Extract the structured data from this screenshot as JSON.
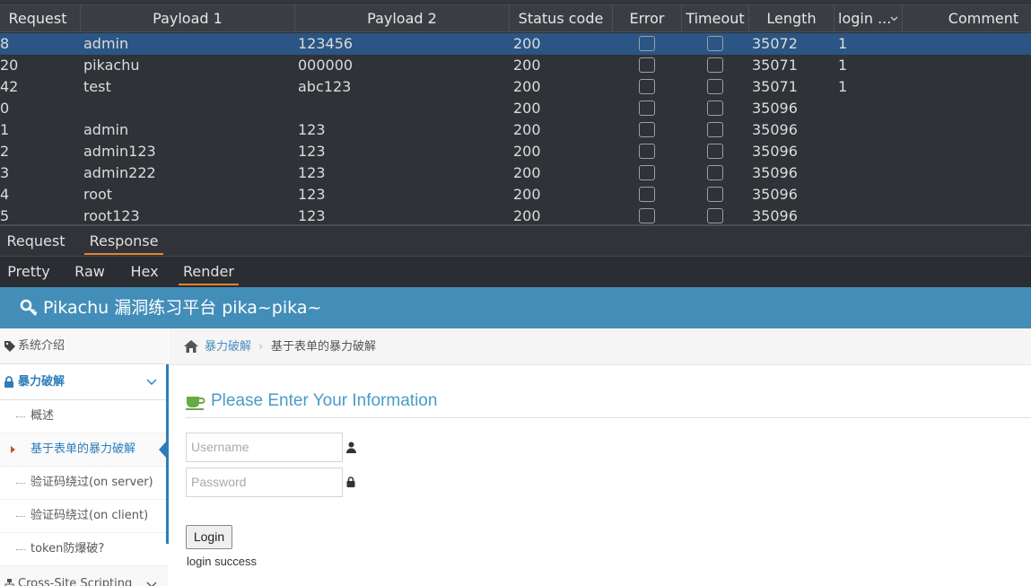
{
  "results": {
    "columns": [
      "Request",
      "Payload 1",
      "Payload 2",
      "Status code",
      "Error",
      "Timeout",
      "Length",
      "login ...",
      "Comment"
    ],
    "rows": [
      {
        "request": "8",
        "payload1": "admin",
        "payload2": "123456",
        "status": "200",
        "length": "35072",
        "login": "1",
        "selected": true
      },
      {
        "request": "20",
        "payload1": "pikachu",
        "payload2": "000000",
        "status": "200",
        "length": "35071",
        "login": "1",
        "selected": false
      },
      {
        "request": "42",
        "payload1": "test",
        "payload2": "abc123",
        "status": "200",
        "length": "35071",
        "login": "1",
        "selected": false
      },
      {
        "request": "0",
        "payload1": "",
        "payload2": "",
        "status": "200",
        "length": "35096",
        "login": "",
        "selected": false
      },
      {
        "request": "1",
        "payload1": "admin",
        "payload2": "123",
        "status": "200",
        "length": "35096",
        "login": "",
        "selected": false
      },
      {
        "request": "2",
        "payload1": "admin123",
        "payload2": "123",
        "status": "200",
        "length": "35096",
        "login": "",
        "selected": false
      },
      {
        "request": "3",
        "payload1": "admin222",
        "payload2": "123",
        "status": "200",
        "length": "35096",
        "login": "",
        "selected": false
      },
      {
        "request": "4",
        "payload1": "root",
        "payload2": "123",
        "status": "200",
        "length": "35096",
        "login": "",
        "selected": false
      },
      {
        "request": "5",
        "payload1": "root123",
        "payload2": "123",
        "status": "200",
        "length": "35096",
        "login": "",
        "selected": false
      }
    ]
  },
  "message_tabs": {
    "request": "Request",
    "response": "Response",
    "active": "Response"
  },
  "view_tabs": {
    "pretty": "Pretty",
    "raw": "Raw",
    "hex": "Hex",
    "render": "Render",
    "active": "Render"
  },
  "render": {
    "site_title": "Pikachu 漏洞练习平台 pika~pika~",
    "sidebar": {
      "intro": "系统介绍",
      "section": "暴力破解",
      "sub_items": [
        "概述",
        "基于表单的暴力破解",
        "验证码绕过(on server)",
        "验证码绕过(on client)",
        "token防爆破?"
      ],
      "active_sub": 1,
      "next_section": "Cross-Site Scripting"
    },
    "breadcrumb": {
      "link": "暴力破解",
      "current": "基于表单的暴力破解"
    },
    "form": {
      "title": "Please Enter Your Information",
      "username_placeholder": "Username",
      "password_placeholder": "Password",
      "login_button": "Login",
      "message": "login success"
    }
  },
  "colors": {
    "selected_row": "#2a5584",
    "header_bar": "#438eb9",
    "link_blue": "#2b7dbc",
    "tab_underline": "#e5822f"
  }
}
